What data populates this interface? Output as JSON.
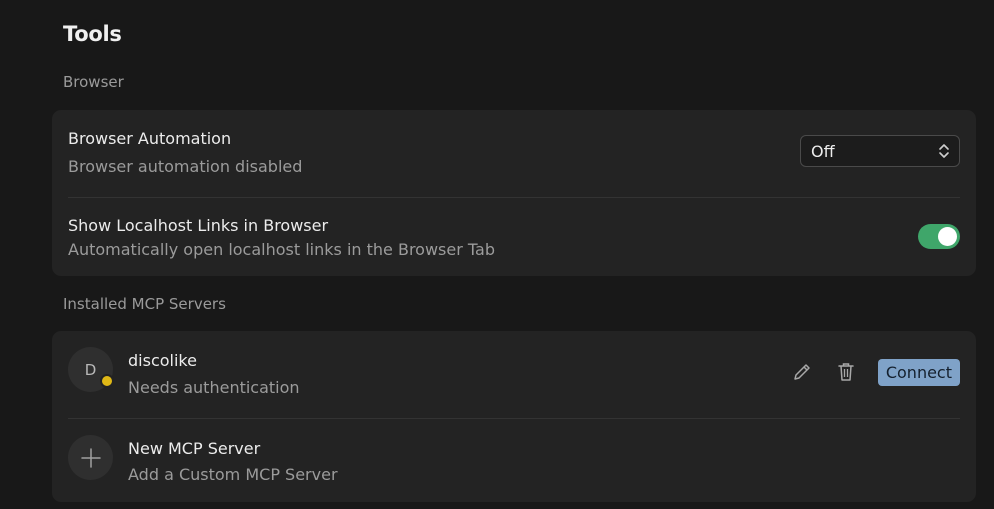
{
  "page": {
    "title": "Tools"
  },
  "browser_section": {
    "label": "Browser",
    "automation": {
      "title": "Browser Automation",
      "subtitle": "Browser automation disabled",
      "select_value": "Off"
    },
    "localhost": {
      "title": "Show Localhost Links in Browser",
      "subtitle": "Automatically open localhost links in the Browser Tab",
      "enabled": true
    }
  },
  "mcp_section": {
    "label": "Installed MCP Servers",
    "servers": [
      {
        "initial": "D",
        "name": "discolike",
        "status": "Needs authentication",
        "status_color": "#e0b816",
        "connect_label": "Connect"
      }
    ],
    "new_server": {
      "title": "New MCP Server",
      "subtitle": "Add a Custom MCP Server"
    }
  },
  "colors": {
    "background": "#181818",
    "card": "#232323",
    "toggle_on": "#3fa66a",
    "connect_button": "#7fa2c8"
  },
  "icons": {
    "select_chevron": "chevron-up-down-icon",
    "edit": "pencil-icon",
    "delete": "trash-icon",
    "add": "plus-icon"
  }
}
